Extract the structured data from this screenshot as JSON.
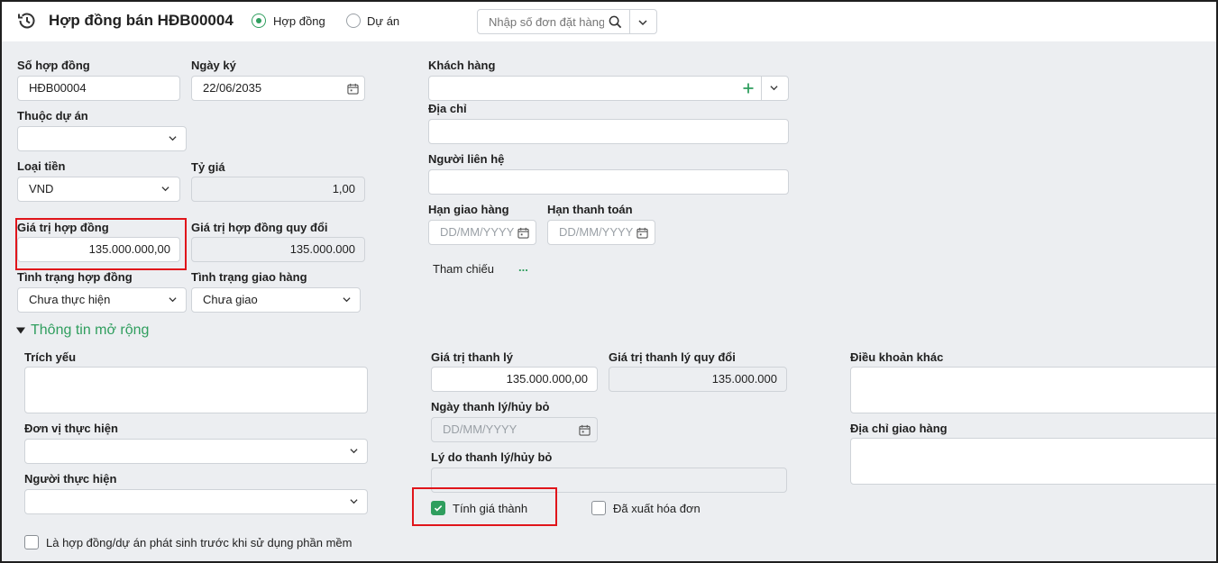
{
  "header": {
    "title": "Hợp đồng bán HĐB00004",
    "radio_contract": "Hợp đồng",
    "radio_project": "Dự án",
    "search_placeholder": "Nhập số đơn đặt hàng"
  },
  "form": {
    "contract_no_label": "Số hợp đồng",
    "contract_no": "HĐB00004",
    "sign_date_label": "Ngày ký",
    "sign_date": "22/06/2035",
    "project_label": "Thuộc dự án",
    "project": "",
    "currency_label": "Loại tiền",
    "currency": "VND",
    "rate_label": "Tỷ giá",
    "rate": "1,00",
    "contract_value_label": "Giá trị hợp đồng",
    "contract_value": "135.000.000,00",
    "converted_value_label": "Giá trị hợp đồng quy đổi",
    "converted_value": "135.000.000",
    "contract_status_label": "Tình trạng hợp đồng",
    "contract_status": "Chưa thực hiện",
    "delivery_status_label": "Tình trạng giao hàng",
    "delivery_status": "Chưa giao",
    "customer_label": "Khách hàng",
    "customer": "",
    "address_label": "Địa chỉ",
    "address": "",
    "contact_label": "Người liên hệ",
    "contact": "",
    "delivery_deadline_label": "Hạn giao hàng",
    "payment_deadline_label": "Hạn thanh toán",
    "date_placeholder": "DD/MM/YYYY",
    "reference_label": "Tham chiếu",
    "reference_more": "..."
  },
  "extended": {
    "section_title": "Thông tin mở rộng",
    "summary_label": "Trích yếu",
    "unit_label": "Đơn vị thực hiện",
    "person_label": "Người thực hiện",
    "pre_software_label": "Là hợp đồng/dự án phát sinh trước khi sử dụng phần mềm",
    "liquidation_value_label": "Giá trị thanh lý",
    "liquidation_value": "135.000.000,00",
    "liquidation_converted_label": "Giá trị thanh lý quy đổi",
    "liquidation_converted": "135.000.000",
    "liquidation_date_label": "Ngày thanh lý/hủy bỏ",
    "liquidation_reason_label": "Lý do thanh lý/hủy bỏ",
    "cost_calc_label": "Tính giá thành",
    "cost_calc_checked": true,
    "invoiced_label": "Đã xuất hóa đơn",
    "invoiced_checked": false,
    "other_terms_label": "Điều khoản khác",
    "delivery_address_label": "Địa chỉ giao hàng"
  },
  "colors": {
    "accent": "#2f9e5e",
    "highlight": "#e0151b"
  }
}
